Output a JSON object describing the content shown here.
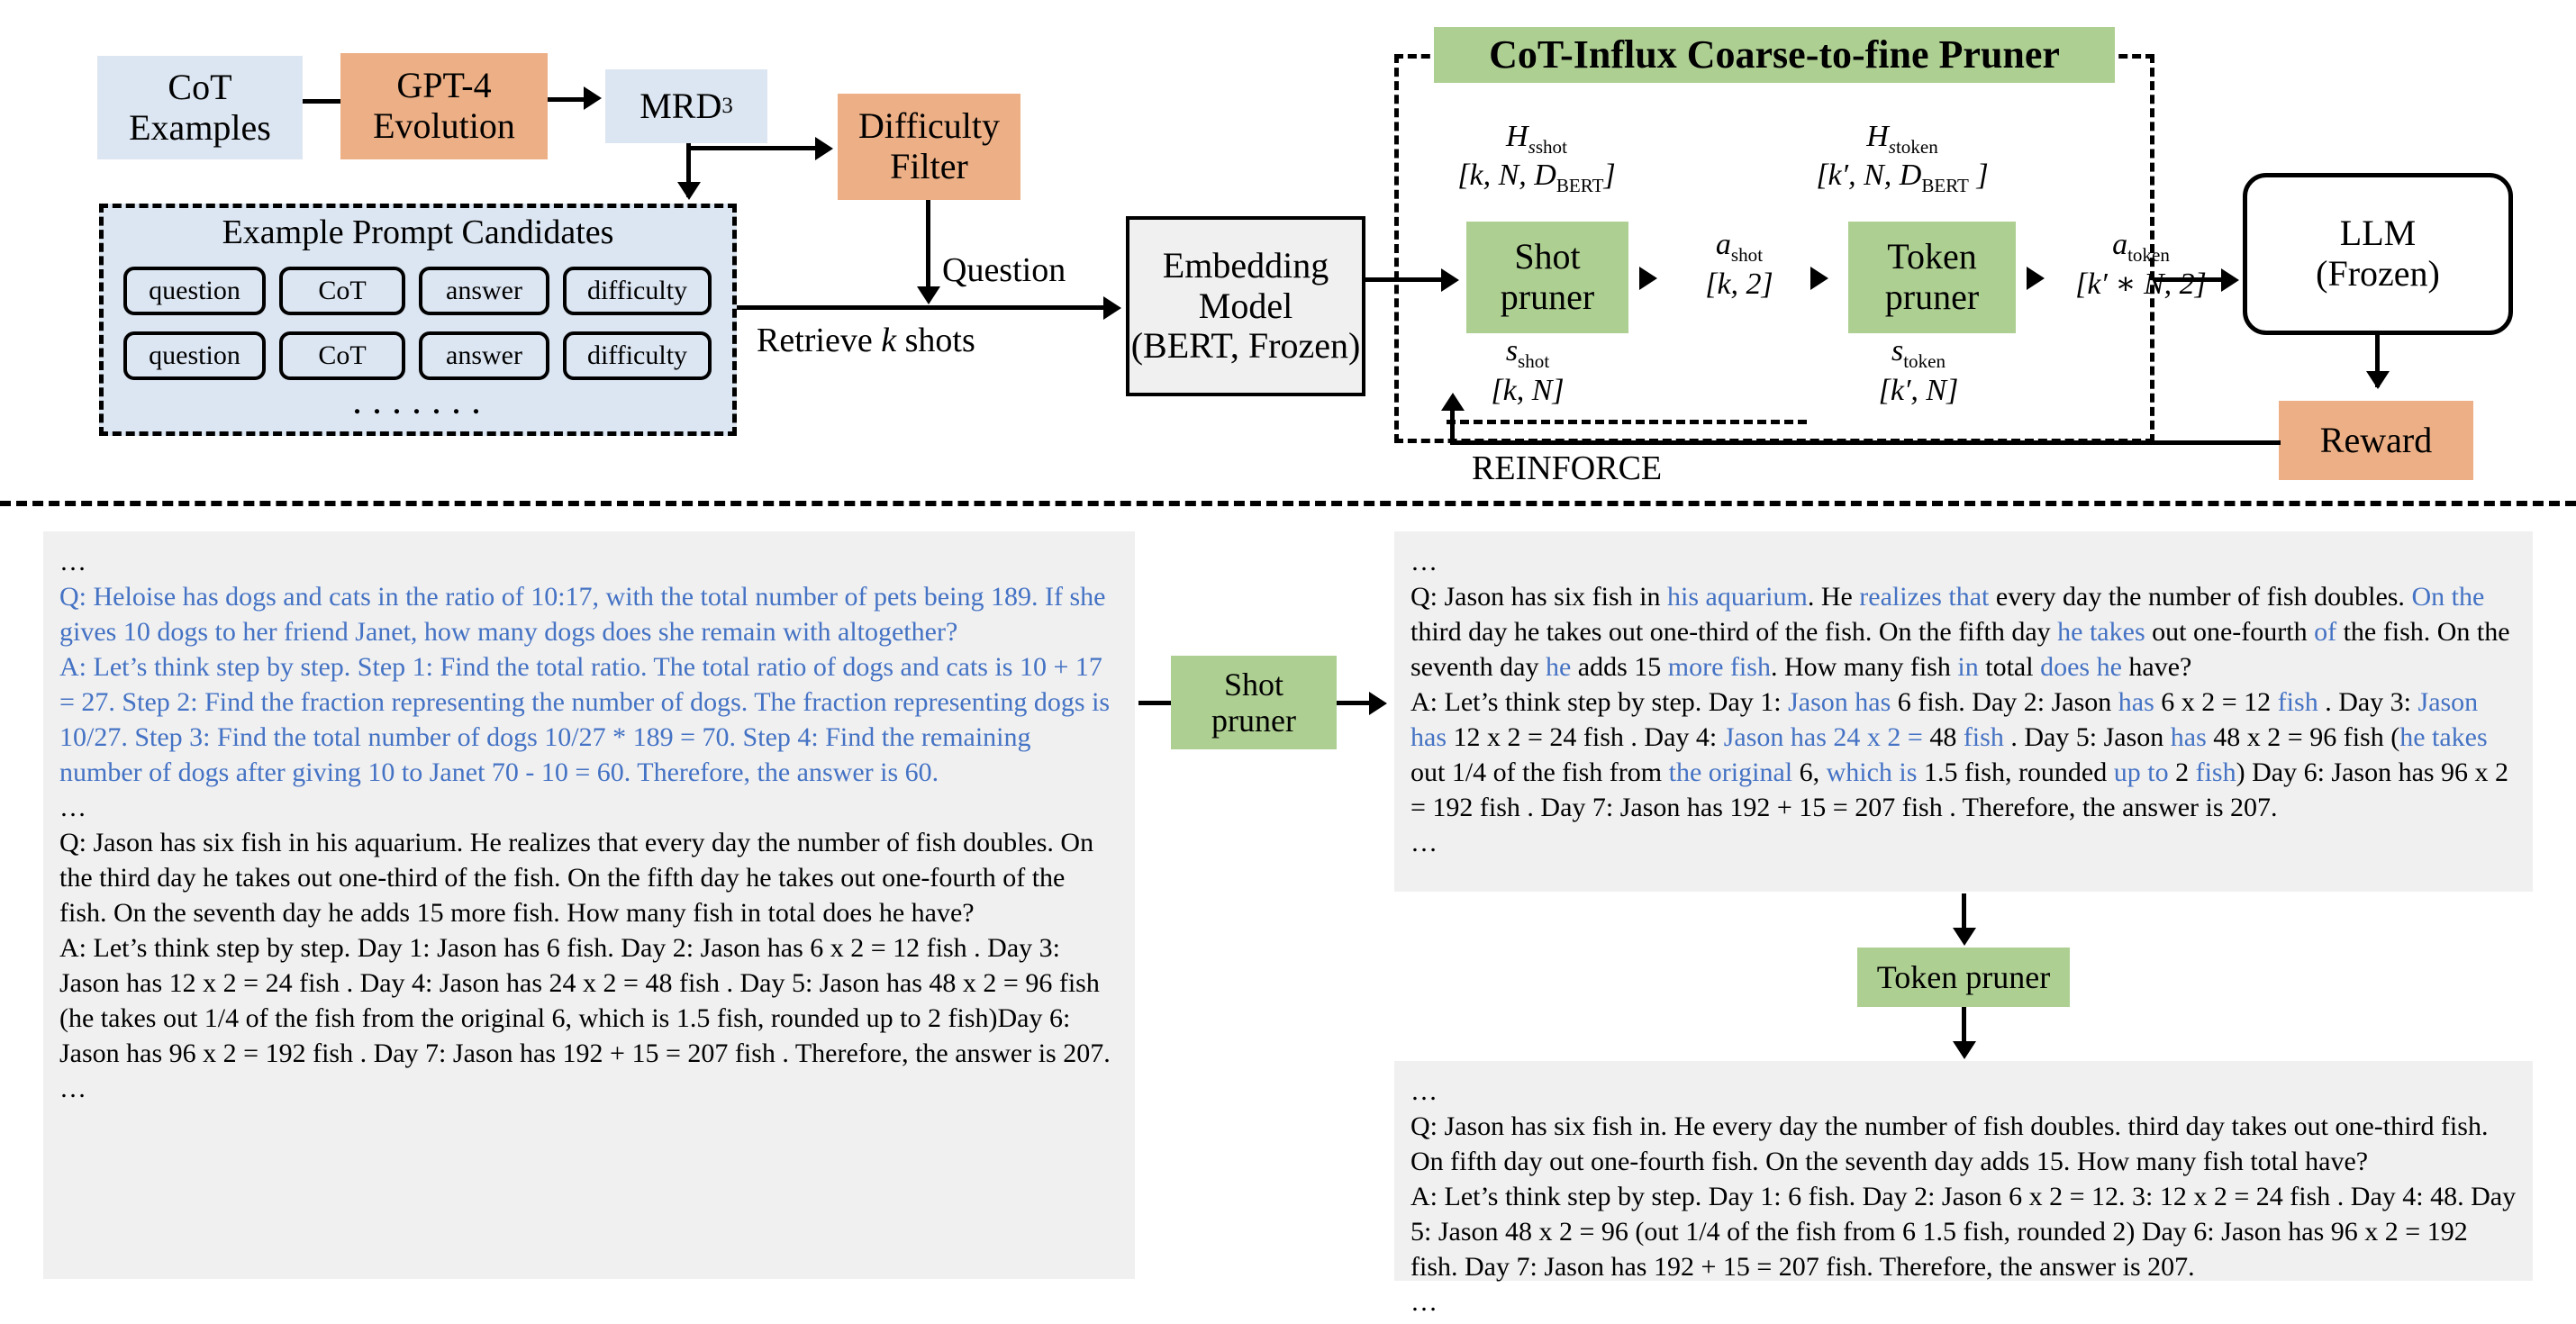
{
  "diagram": {
    "title": "CoT-Influx Coarse-to-fine Pruner",
    "nodes": {
      "cot_examples": "CoT\nExamples",
      "gpt4_evolution": "GPT-4\nEvolution",
      "mrd3": "MRD",
      "mrd3_sup": "3",
      "difficulty_filter": "Difficulty\nFilter",
      "example_prompt_candidates": "Example Prompt Candidates",
      "embedding_model": "Embedding\nModel\n(BERT, Frozen)",
      "shot_pruner": "Shot\npruner",
      "token_pruner": "Token\npruner",
      "llm": "LLM\n(Frozen)",
      "reward": "Reward"
    },
    "chips": [
      "question",
      "CoT",
      "answer",
      "difficulty"
    ],
    "chips_row2": [
      "question",
      "CoT",
      "answer",
      "difficulty"
    ],
    "ellipsis": ". . . . . . .",
    "edge_labels": {
      "question": "Question",
      "retrieve_k_shots": "Retrieve k shots",
      "reinforce": "REINFORCE"
    },
    "tensor_labels": {
      "h_s_shot_sym": "H",
      "h_s_shot_sub": "s",
      "h_s_shot_sub2": "shot",
      "h_s_shot_shape": "[k, N, D",
      "h_s_shot_shape_sub": "BERT",
      "h_s_shot_shape_end": "]",
      "h_s_token_sub2": "token",
      "h_s_token_shape": "[k′, N, D",
      "a_shot_sym": "a",
      "a_shot_sub": "shot",
      "a_shot_shape": "[k, 2]",
      "a_token_sub": "token",
      "a_token_shape": "[k′ ∗ N, 2]",
      "s_shot_sym": "s",
      "s_shot_sub": "shot",
      "s_shot_shape": "[k, N]",
      "s_token_sub": "token",
      "s_token_shape": "[k′, N]"
    }
  },
  "bottom": {
    "shot_pruner_label": "Shot\npruner",
    "token_pruner_label": "Token\npruner",
    "left_panel": {
      "lead_dots": "…",
      "mid_dots": "…",
      "tail_dots": "…",
      "blue_q": "Q: Heloise has dogs and cats in the ratio of 10:17, with the total number of pets being 189. If she gives 10 dogs to her friend Janet, how many dogs does she remain with altogether?",
      "blue_a": "A: Let’s think step by step. Step 1: Find the total ratio. The total ratio of dogs and cats is 10 + 17 = 27. Step 2: Find the fraction representing the number of dogs. The fraction representing dogs is 10/27. Step 3: Find the total number of dogs 10/27 * 189 = 70. Step 4: Find the remaining number of dogs after giving 10 to Janet 70 - 10 = 60. Therefore, the answer is 60.",
      "black_q": "Q: Jason has six fish in his aquarium. He realizes that every day the number of fish doubles. On the third day he takes out one-third of the fish. On the fifth day he takes out one-fourth of the fish. On the seventh day he adds 15 more fish. How many fish in total does he have?",
      "black_a": "A: Let’s think step by step. Day 1: Jason has 6 fish. Day 2: Jason has 6 x 2 = 12 fish . Day 3: Jason has 12 x 2 = 24 fish . Day 4: Jason has 24 x 2 = 48 fish . Day 5: Jason has 48 x 2 = 96 fish (he takes out 1/4 of the fish from the original 6, which is 1.5 fish, rounded up to 2 fish)Day 6: Jason has 96 x 2 = 192 fish . Day 7: Jason has 192 + 15 = 207 fish . Therefore, the answer is 207."
    },
    "shot_pruned_panel": {
      "lead_dots": "…",
      "tail_dots": "…",
      "q_segments": [
        {
          "t": "Q: Jason has six fish in ",
          "c": "k"
        },
        {
          "t": "his aquarium",
          "c": "b"
        },
        {
          "t": ". He ",
          "c": "k"
        },
        {
          "t": "realizes that",
          "c": "b"
        },
        {
          "t": " every day the number of fish doubles. ",
          "c": "k"
        },
        {
          "t": "On the",
          "c": "b"
        },
        {
          "t": " third day he takes out one-third of the fish. On the fifth day ",
          "c": "k"
        },
        {
          "t": "he takes",
          "c": "b"
        },
        {
          "t": " out one-fourth ",
          "c": "k"
        },
        {
          "t": "of",
          "c": "b"
        },
        {
          "t": " the fish. On the seventh day ",
          "c": "k"
        },
        {
          "t": "he",
          "c": "b"
        },
        {
          "t": " adds 15 ",
          "c": "k"
        },
        {
          "t": "more fish",
          "c": "b"
        },
        {
          "t": ". How many fish ",
          "c": "k"
        },
        {
          "t": "in",
          "c": "b"
        },
        {
          "t": " total ",
          "c": "k"
        },
        {
          "t": "does he",
          "c": "b"
        },
        {
          "t": " have?",
          "c": "k"
        }
      ],
      "a_segments": [
        {
          "t": "A: Let’s think step by step. Day 1: ",
          "c": "k"
        },
        {
          "t": "Jason has",
          "c": "b"
        },
        {
          "t": " 6 fish. Day 2: Jason ",
          "c": "k"
        },
        {
          "t": "has",
          "c": "b"
        },
        {
          "t": " 6 x 2 = 12 ",
          "c": "k"
        },
        {
          "t": "fish",
          "c": "b"
        },
        {
          "t": " . Day 3: ",
          "c": "k"
        },
        {
          "t": "Jason has",
          "c": "b"
        },
        {
          "t": " 12 x 2 = 24 fish . Day 4: ",
          "c": "k"
        },
        {
          "t": "Jason has 24 x 2 =",
          "c": "b"
        },
        {
          "t": " 48 ",
          "c": "k"
        },
        {
          "t": "fish",
          "c": "b"
        },
        {
          "t": " . Day 5: Jason ",
          "c": "k"
        },
        {
          "t": "has",
          "c": "b"
        },
        {
          "t": " 48 x 2 = 96 fish (",
          "c": "k"
        },
        {
          "t": "he takes",
          "c": "b"
        },
        {
          "t": " out 1/4 of the fish from ",
          "c": "k"
        },
        {
          "t": "the original",
          "c": "b"
        },
        {
          "t": " 6, ",
          "c": "k"
        },
        {
          "t": "which is",
          "c": "b"
        },
        {
          "t": " 1.5 fish, rounded ",
          "c": "k"
        },
        {
          "t": "up to",
          "c": "b"
        },
        {
          "t": " 2 ",
          "c": "k"
        },
        {
          "t": "fish",
          "c": "b"
        },
        {
          "t": ") Day 6: Jason has 96 x 2 = 192 fish . Day 7: Jason has 192 + 15 = 207 fish . Therefore, the answer is 207.",
          "c": "k"
        }
      ]
    },
    "token_pruned_panel": {
      "lead_dots": "…",
      "tail_dots": "…",
      "q": "Q: Jason has six fish in. He every day the number of fish doubles. third day takes out one-third fish. On fifth day out one-fourth fish. On the seventh day adds 15. How many fish total have?",
      "a": "A: Let’s think step by step. Day 1: 6 fish. Day 2: Jason 6 x 2 = 12. 3: 12 x 2 = 24 fish . Day 4: 48. Day 5: Jason 48 x 2 = 96 (out 1/4 of the fish from 6 1.5 fish, rounded 2) Day 6: Jason has 96 x 2 = 192 fish. Day 7: Jason has 192 + 15 = 207 fish. Therefore, the answer is 207."
    }
  },
  "colors": {
    "blue_box": "#dce6f2",
    "orange_box": "#edaf85",
    "green_box": "#aecf92",
    "grey_panel": "#f0f0f0",
    "blue_text": "#4472c4"
  }
}
